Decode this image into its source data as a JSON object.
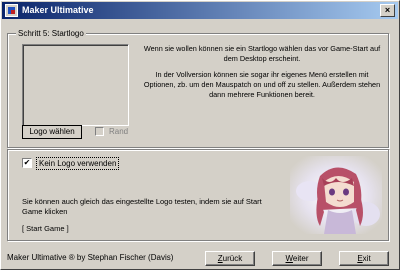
{
  "window": {
    "title": "Maker Ultimative",
    "close_glyph": "×"
  },
  "step_group": {
    "title": "Schritt 5: Startlogo",
    "info_p1": "Wenn sie wollen können sie ein Startlogo wählen das vor Game-Start auf dem Desktop erscheint.",
    "info_p2": "In der Vollversion können sie sogar ihr eigenes Menü erstellen mit Optionen, zb. um den Mauspatch on und off zu stellen. Außerdem stehen dann mehrere Funktionen bereit.",
    "choose_logo_label": "Logo wählen",
    "border_label": "Rand",
    "border_checked": false
  },
  "test_group": {
    "no_logo_label": "Kein Logo verwenden",
    "no_logo_checked": true,
    "check_glyph": "✔",
    "test_text": "Sie können auch gleich das eingestellte Logo testen, indem sie auf Start Game klicken",
    "start_game_label": "[ Start Game ]"
  },
  "footer": {
    "credits": "Maker Ultimative ® by Stephan Fischer (Davis)",
    "back_key": "Z",
    "back_rest": "urück",
    "next_key": "W",
    "next_rest": "eiter",
    "exit_key": "E",
    "exit_rest": "xit"
  },
  "icons": {
    "app": "app-icon",
    "close": "close-icon",
    "portrait": "anime-portrait-image"
  },
  "colors": {
    "titlebar_start": "#0a246a",
    "titlebar_end": "#a6caf0",
    "face": "#d4d0c8"
  }
}
